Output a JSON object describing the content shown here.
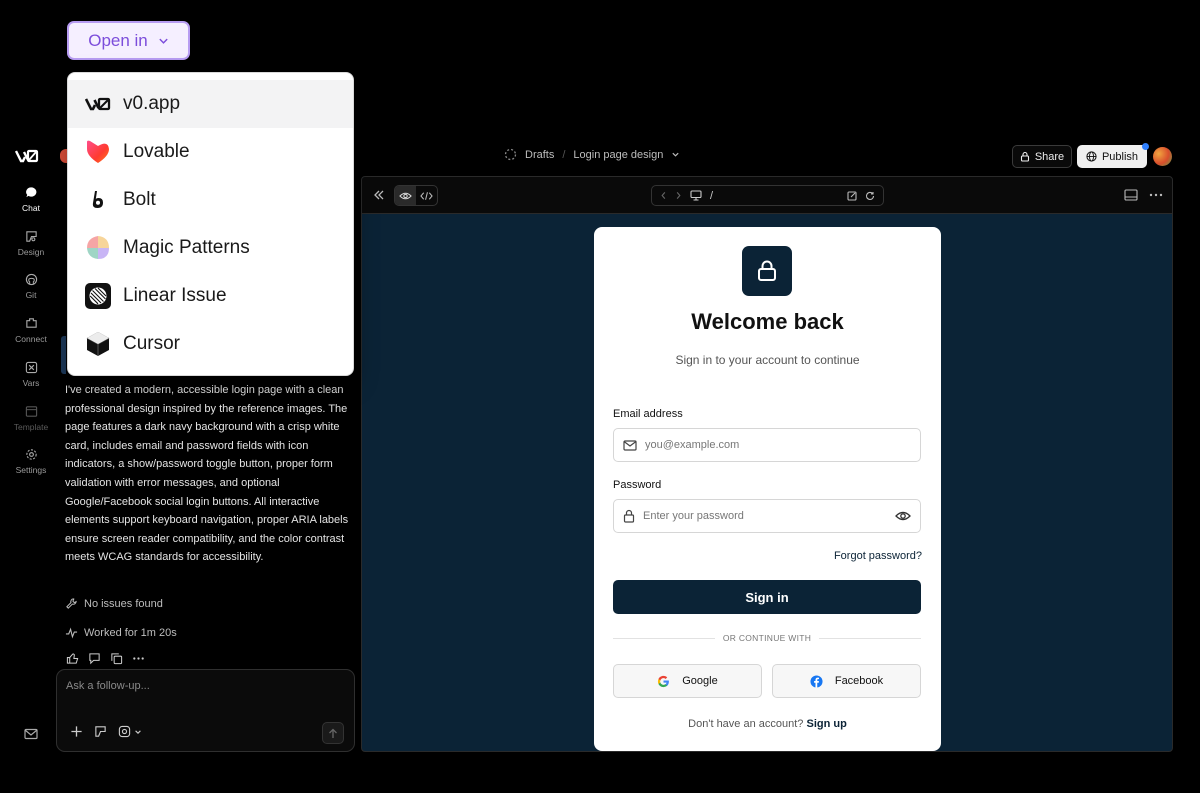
{
  "open_in": {
    "label": "Open in",
    "items": [
      {
        "label": "v0.app",
        "icon": "v0-logo-icon"
      },
      {
        "label": "Lovable",
        "icon": "lovable-heart-icon"
      },
      {
        "label": "Bolt",
        "icon": "bolt-icon"
      },
      {
        "label": "Magic Patterns",
        "icon": "magic-patterns-icon"
      },
      {
        "label": "Linear Issue",
        "icon": "linear-icon"
      },
      {
        "label": "Cursor",
        "icon": "cursor-icon"
      }
    ]
  },
  "header": {
    "breadcrumb": [
      "Drafts",
      "Login page design"
    ],
    "share_label": "Share",
    "publish_label": "Publish"
  },
  "rail": [
    {
      "label": "Chat",
      "icon": "chat-icon"
    },
    {
      "label": "Design",
      "icon": "design-icon"
    },
    {
      "label": "Git",
      "icon": "github-icon"
    },
    {
      "label": "Connect",
      "icon": "connect-icon"
    },
    {
      "label": "Vars",
      "icon": "vars-icon"
    },
    {
      "label": "Template",
      "icon": "template-icon"
    },
    {
      "label": "Settings",
      "icon": "gear-icon"
    }
  ],
  "chat": {
    "message": "I've created a modern, accessible login page with a clean professional design inspired by the reference images. The page features a dark navy background with a crisp white card, includes email and password fields with icon indicators, a show/password toggle button, proper form validation with error messages, and optional Google/Facebook social login buttons. All interactive elements support keyboard navigation, proper ARIA labels ensure screen reader compatibility, and the color contrast meets WCAG standards for accessibility.",
    "issues": "No issues found",
    "worked": "Worked for 1m 20s",
    "composer_placeholder": "Ask a follow-up..."
  },
  "preview": {
    "url": "/"
  },
  "login": {
    "title": "Welcome back",
    "subtitle": "Sign in to your account to continue",
    "email_label": "Email address",
    "email_placeholder": "you@example.com",
    "password_label": "Password",
    "password_placeholder": "Enter your password",
    "forgot": "Forgot password?",
    "signin": "Sign in",
    "divider": "OR CONTINUE WITH",
    "google": "Google",
    "facebook": "Facebook",
    "no_account": "Don't have an account?",
    "signup": "Sign up"
  },
  "colors": {
    "navy": "#0b2336",
    "accent_purple": "#7c4ddb",
    "publish_dot": "#2f80ff"
  }
}
